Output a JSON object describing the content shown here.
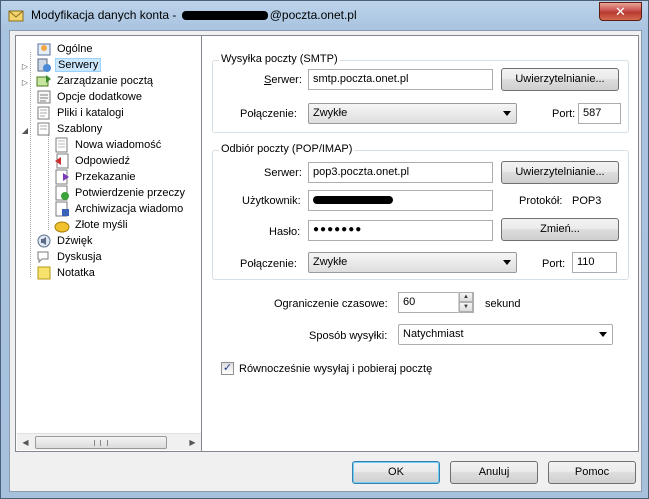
{
  "window": {
    "title_prefix": "Modyfikacja danych konta - ",
    "title_suffix": "@poczta.onet.pl",
    "close_label": "✕"
  },
  "tree": {
    "items": [
      {
        "label": "Ogólne",
        "icon": "general-settings-icon"
      },
      {
        "label": "Serwery",
        "icon": "servers-icon"
      },
      {
        "label": "Zarządzanie pocztą",
        "icon": "mail-management-icon"
      },
      {
        "label": "Opcje dodatkowe",
        "icon": "additional-options-icon"
      },
      {
        "label": "Pliki i katalogi",
        "icon": "folder-icon"
      },
      {
        "label": "Szablony",
        "icon": "templates-icon"
      },
      {
        "label": "Nowa wiadomość",
        "icon": "new-message-icon"
      },
      {
        "label": "Odpowiedź",
        "icon": "reply-icon"
      },
      {
        "label": "Przekazanie",
        "icon": "forward-icon"
      },
      {
        "label": "Potwierdzenie przeczy",
        "icon": "read-receipt-icon"
      },
      {
        "label": "Archiwizacja wiadomo",
        "icon": "archive-icon"
      },
      {
        "label": "Złote myśli",
        "icon": "quotes-icon"
      },
      {
        "label": "Dźwięk",
        "icon": "sound-icon"
      },
      {
        "label": "Dyskusja",
        "icon": "discussion-icon"
      },
      {
        "label": "Notatka",
        "icon": "note-icon"
      }
    ]
  },
  "smtp": {
    "group_title": "Wysyłka poczty (SMTP)",
    "server_label": "Serwer:",
    "server_value": "smtp.poczta.onet.pl",
    "auth_button": "Uwierzytelnianie...",
    "connection_label": "Połączenie:",
    "connection_value": "Zwykłe",
    "port_label": "Port:",
    "port_value": "587"
  },
  "pop": {
    "group_title": "Odbiór poczty (POP/IMAP)",
    "server_label": "Serwer:",
    "server_value": "pop3.poczta.onet.pl",
    "auth_button": "Uwierzytelnianie...",
    "user_label": "Użytkownik:",
    "protocol_label": "Protokół:",
    "protocol_value": "POP3",
    "password_label": "Hasło:",
    "password_value": "●●●●●●●",
    "change_button": "Zmień...",
    "connection_label": "Połączenie:",
    "connection_value": "Zwykłe",
    "port_label": "Port:",
    "port_value": "110"
  },
  "options": {
    "timeout_label": "Ograniczenie czasowe:",
    "timeout_value": "60",
    "timeout_unit": "sekund",
    "send_mode_label": "Sposób wysyłki:",
    "send_mode_value": "Natychmiast",
    "simultaneous_label": "Równocześnie wysyłaj i pobieraj pocztę",
    "simultaneous_checked": true
  },
  "footer": {
    "ok": "OK",
    "cancel": "Anuluj",
    "help": "Pomoc"
  }
}
